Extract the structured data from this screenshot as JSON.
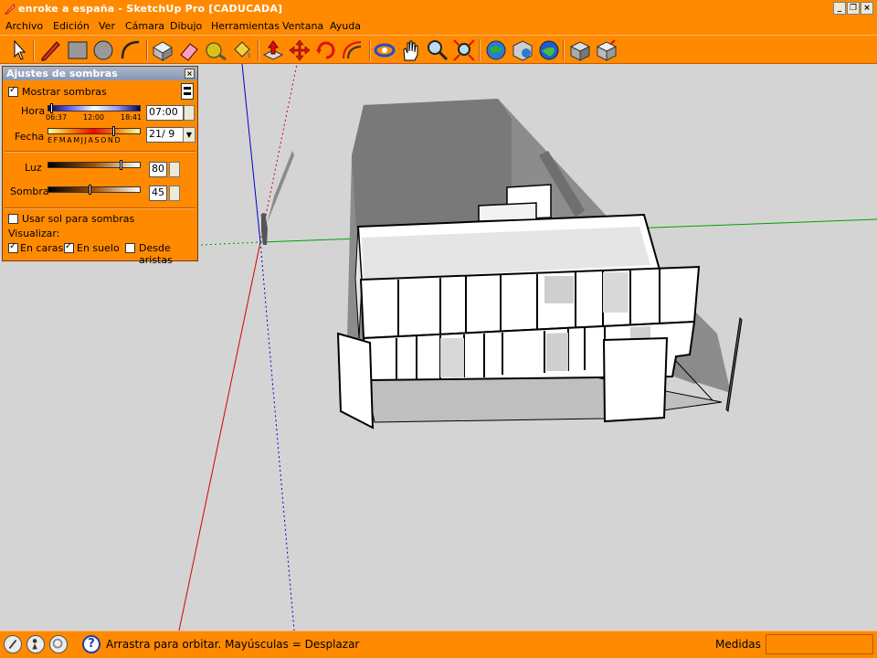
{
  "window": {
    "title": "enroke a españa - SketchUp Pro [CADUCADA]",
    "minimize": "_",
    "restore": "❐",
    "close": "×"
  },
  "menu": [
    "Archivo",
    "Edición",
    "Ver",
    "Cámara",
    "Dibujo",
    "Herramientas",
    "Ventana",
    "Ayuda"
  ],
  "toolbar": {
    "tools": [
      "select-icon",
      "pencil-icon",
      "rectangle-icon",
      "circle-icon",
      "arc-icon",
      "make-component-icon",
      "eraser-icon",
      "tape-measure-icon",
      "paint-bucket-icon",
      "push-pull-icon",
      "move-icon",
      "rotate-icon",
      "offset-icon",
      "orbit-icon",
      "pan-icon",
      "zoom-icon",
      "zoom-extents-icon",
      "get-models-icon",
      "share-model-icon",
      "google-earth-icon",
      "get-components-icon",
      "share-component-icon"
    ]
  },
  "shadow_panel": {
    "title": "Ajustes de sombras",
    "close": "×",
    "show_shadows": {
      "label": "Mostrar sombras",
      "checked": true
    },
    "time": {
      "label": "Hora",
      "sunrise": "06:37",
      "noon": "12:00",
      "sunset": "18:41",
      "value": "07:00",
      "slider_fraction": 0.03
    },
    "date": {
      "label": "Fecha",
      "months": "E F M A M J J A S O N D",
      "value": "21/ 9",
      "slider_fraction": 0.72
    },
    "light": {
      "label": "Luz",
      "value": "80",
      "slider_fraction": 0.8
    },
    "dark": {
      "label": "Sombra",
      "value": "45",
      "slider_fraction": 0.45
    },
    "use_sun": {
      "label": "Usar sol para sombras",
      "checked": false
    },
    "display_label": "Visualizar:",
    "on_faces": {
      "label": "En caras",
      "checked": true
    },
    "on_ground": {
      "label": "En suelo",
      "checked": true
    },
    "from_edges": {
      "label": "Desde aristas",
      "checked": false
    }
  },
  "status": {
    "hint": "Arrastra para orbitar. Mayúsculas = Desplazar",
    "measure_label": "Medidas",
    "measure_value": ""
  },
  "colors": {
    "accent": "#ff8a00",
    "viewport": "#d4d4d4",
    "axis_red": "#d40000",
    "axis_green": "#00a000",
    "axis_blue": "#0000d0"
  }
}
